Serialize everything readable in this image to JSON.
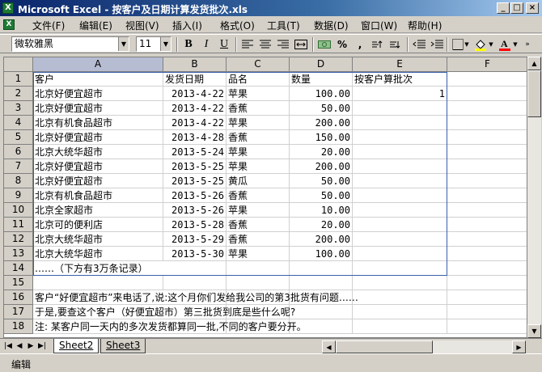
{
  "window": {
    "title": "Microsoft Excel - 按客户及日期计算发货批次.xls",
    "app_icon": "X",
    "min": "_",
    "max": "□",
    "close": "×"
  },
  "menu": [
    {
      "label": "文件(F)"
    },
    {
      "label": "编辑(E)"
    },
    {
      "label": "视图(V)"
    },
    {
      "label": "插入(I)"
    },
    {
      "label": "格式(O)"
    },
    {
      "label": "工具(T)"
    },
    {
      "label": "数据(D)"
    },
    {
      "label": "窗口(W)"
    },
    {
      "label": "帮助(H)"
    }
  ],
  "toolbar": {
    "font_name": "微软雅黑",
    "font_size": "11",
    "bold": "B",
    "italic": "I",
    "underline": "U",
    "percent": "%",
    "comma": ","
  },
  "columns": [
    "A",
    "B",
    "C",
    "D",
    "E",
    "F"
  ],
  "selected_column": "A",
  "rows": [
    {
      "n": "1",
      "a": "客户",
      "b": "发货日期",
      "c": "品名",
      "d": "数量",
      "e": "按客户算批次"
    },
    {
      "n": "2",
      "a": "北京好便宜超市",
      "b": "2013-4-22",
      "c": "苹果",
      "d": "100.00",
      "e": "1"
    },
    {
      "n": "3",
      "a": "北京好便宜超市",
      "b": "2013-4-22",
      "c": "香蕉",
      "d": "50.00",
      "e": ""
    },
    {
      "n": "4",
      "a": "北京有机食品超市",
      "b": "2013-4-22",
      "c": "苹果",
      "d": "200.00",
      "e": ""
    },
    {
      "n": "5",
      "a": "北京好便宜超市",
      "b": "2013-4-28",
      "c": "香蕉",
      "d": "150.00",
      "e": ""
    },
    {
      "n": "6",
      "a": "北京大统华超市",
      "b": "2013-5-24",
      "c": "苹果",
      "d": "20.00",
      "e": ""
    },
    {
      "n": "7",
      "a": "北京好便宜超市",
      "b": "2013-5-25",
      "c": "苹果",
      "d": "200.00",
      "e": ""
    },
    {
      "n": "8",
      "a": "北京好便宜超市",
      "b": "2013-5-25",
      "c": "黄瓜",
      "d": "50.00",
      "e": ""
    },
    {
      "n": "9",
      "a": "北京有机食品超市",
      "b": "2013-5-26",
      "c": "香蕉",
      "d": "50.00",
      "e": ""
    },
    {
      "n": "10",
      "a": "北京全家超市",
      "b": "2013-5-26",
      "c": "苹果",
      "d": "10.00",
      "e": ""
    },
    {
      "n": "11",
      "a": "北京可的便利店",
      "b": "2013-5-28",
      "c": "香蕉",
      "d": "20.00",
      "e": ""
    },
    {
      "n": "12",
      "a": "北京大统华超市",
      "b": "2013-5-29",
      "c": "香蕉",
      "d": "200.00",
      "e": ""
    },
    {
      "n": "13",
      "a": "北京大统华超市",
      "b": "2013-5-30",
      "c": "苹果",
      "d": "100.00",
      "e": ""
    },
    {
      "n": "14",
      "a": "……（下方有3万条记录）",
      "b": "",
      "c": "",
      "d": "",
      "e": ""
    },
    {
      "n": "15",
      "a": "",
      "b": "",
      "c": "",
      "d": "",
      "e": ""
    },
    {
      "n": "16",
      "a": "客户“好便宜超市”来电话了,说:这个月你们发给我公司的第3批货有问题……",
      "b": "",
      "c": "",
      "d": "",
      "e": ""
    },
    {
      "n": "17",
      "a": "于是,要查这个客户（好便宜超市）第三批货到底是些什么呢?",
      "b": "",
      "c": "",
      "d": "",
      "e": ""
    },
    {
      "n": "18",
      "a": "注: 某客户同一天内的多次发货都算同一批,不同的客户要分开。",
      "b": "",
      "c": "",
      "d": "",
      "e": ""
    }
  ],
  "sheet_tabs": [
    {
      "label": "Sheet2"
    },
    {
      "label": "Sheet3"
    }
  ],
  "status": "编辑",
  "colors": {
    "title_gradient_start": "#0a246a",
    "selection_border": "#3a5fa8",
    "header_selected": "#b6bdd2"
  }
}
